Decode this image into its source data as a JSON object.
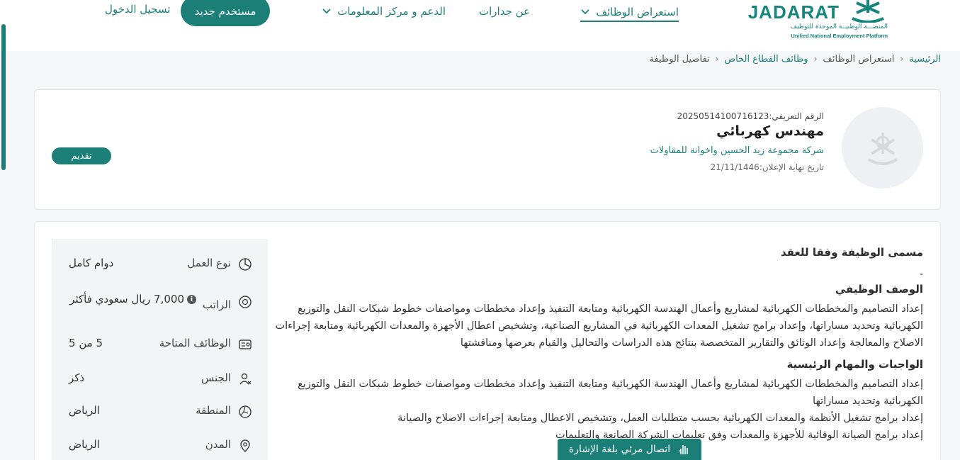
{
  "header": {
    "logo_text": "JADARAT",
    "logo_ar": "المنصـــة الوطنيــة الموحدة للتوظيف",
    "logo_en": "Unified National Employment Platform",
    "nav": [
      {
        "label": "استعراض الوظائف",
        "active": true,
        "dropdown": true
      },
      {
        "label": "عن جدارات",
        "active": false,
        "dropdown": false
      },
      {
        "label": "الدعم و مركز المعلومات",
        "active": false,
        "dropdown": true
      }
    ],
    "register_label": "مستخدم جديد",
    "login_label": "تسجيل الدخول"
  },
  "breadcrumb": [
    {
      "label": "الرئيسية",
      "link": true
    },
    {
      "label": "استعراض الوظائف",
      "link": false
    },
    {
      "label": "وظائف القطاع الخاص",
      "link": true
    },
    {
      "label": "تفاصيل الوظيفة",
      "link": false
    }
  ],
  "job": {
    "id_text": "الرقم التعريفي:20250514100716123",
    "title": "مهندس كهربائي",
    "company": "شركة مجموعة زيد الحسين واخوانة للمقاولات",
    "deadline": "تاريخ نهاية الإعلان:21/11/1446",
    "apply_label": "تقديم"
  },
  "info": [
    {
      "icon": "pie-chart-icon",
      "label": "نوع العمل",
      "value": "دوام كامل"
    },
    {
      "icon": "money-icon",
      "label": "الراتب",
      "value": "7,000 ريال سعودي فأكثر",
      "info_icon": true
    },
    {
      "icon": "id-card-icon",
      "label": "الوظائف المتاحة",
      "value": "5 من 5"
    },
    {
      "icon": "gender-icon",
      "label": "الجنس",
      "value": "ذكر"
    },
    {
      "icon": "map-region-icon",
      "label": "المنطقة",
      "value": "الرياض"
    },
    {
      "icon": "location-pin-icon",
      "label": "المدن",
      "value": "الرياض"
    }
  ],
  "description": {
    "contract_title_heading": "مسمى الوظيفة وفقا للعقد",
    "contract_title_value": "-",
    "job_desc_heading": "الوصف الوظيفي",
    "job_desc_text": "إعداد التصاميم والمخططات الكهربائية لمشاريع وأعمال الهندسة الكهربائية ومتابعة التنفيذ وإعداد مخططات ومواصفات خطوط شبكات النقل والتوزيع الكهربائية وتحديد مساراتها، وإعداد برامج تشغيل المعدات الكهربائية في المشاريع الصناعية، وتشخيص اعطال الأجهزة والمعدات الكهربائية ومتابعة إجراءات الاصلاح والمعالجة وإعداد الوثائق والتقارير المتخصصة بنتائج هذه الدراسات والتحاليل والقيام بعرضها ومناقشتها",
    "duties_heading": "الواجبات والمهام الرئيسية",
    "duties": [
      "إعداد التصاميم والمخططات الكهربائية لمشاريع وأعمال الهندسة الكهربائية ومتابعة التنفيذ وإعداد مخططات ومواصفات خطوط شبكات النقل والتوزيع الكهربائية وتحديد مساراتها",
      "إعداد برامج تشغيل الأنظمة والمعدات الكهربائية بحسب متطلبات العمل، وتشخيص الاعطال ومتابعة إجراءات الاصلاح والصيانة",
      "إعداد برامج الصيانة الوقائية للأجهزة والمعدات وفق تعليمات الشركة الصانعة والتعليمات"
    ]
  },
  "sign_language_label": "اتصال مرئي بلغة الإشارة"
}
